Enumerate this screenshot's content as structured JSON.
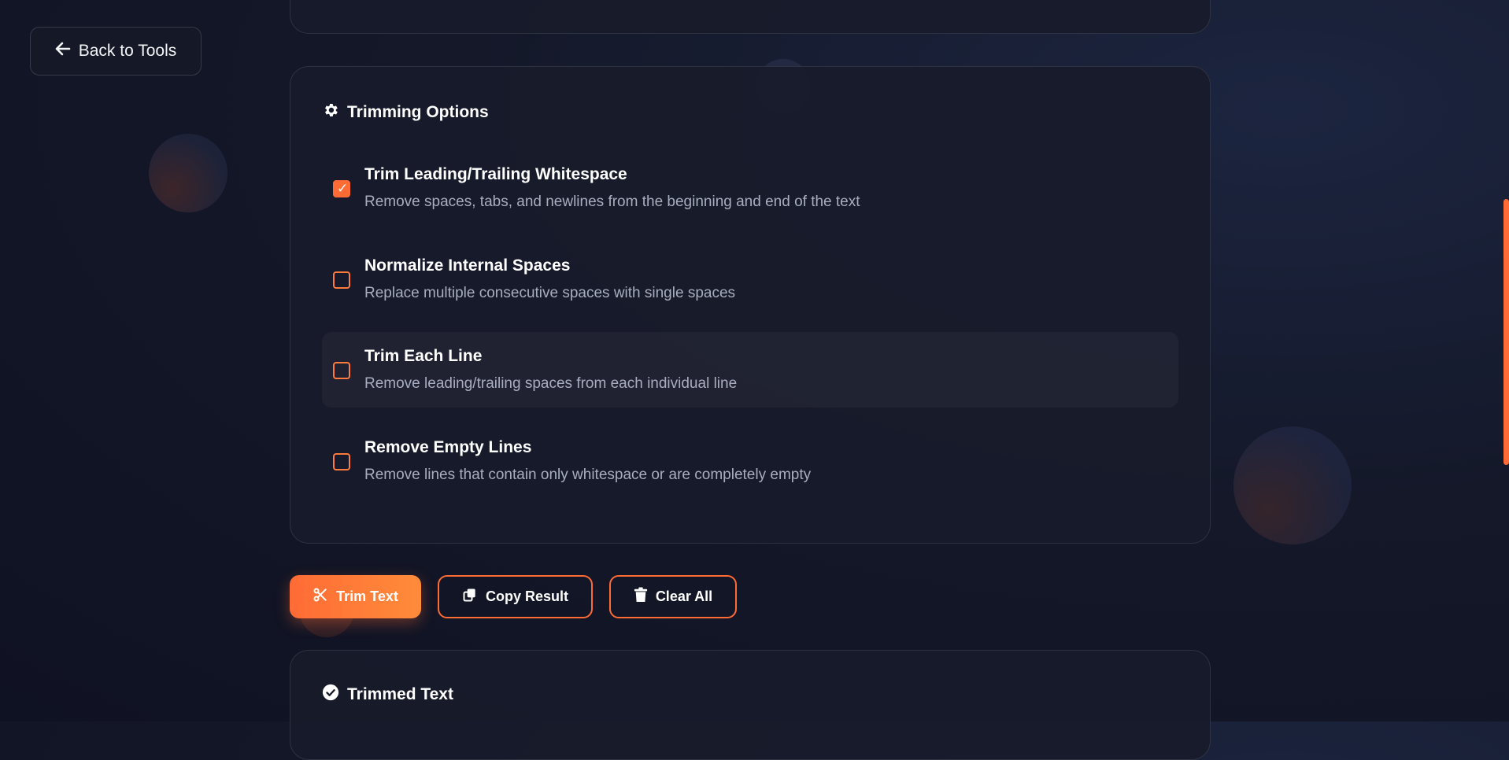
{
  "nav": {
    "back_label": "Back to Tools"
  },
  "options_section": {
    "title": "Trimming Options",
    "items": [
      {
        "label": "Trim Leading/Trailing Whitespace",
        "description": "Remove spaces, tabs, and newlines from the beginning and end of the text",
        "checked": true
      },
      {
        "label": "Normalize Internal Spaces",
        "description": "Replace multiple consecutive spaces with single spaces",
        "checked": false
      },
      {
        "label": "Trim Each Line",
        "description": "Remove leading/trailing spaces from each individual line",
        "checked": false
      },
      {
        "label": "Remove Empty Lines",
        "description": "Remove lines that contain only whitespace or are completely empty",
        "checked": false
      }
    ]
  },
  "actions": {
    "trim_label": "Trim Text",
    "copy_label": "Copy Result",
    "clear_label": "Clear All"
  },
  "result_section": {
    "title": "Trimmed Text"
  },
  "icons": {
    "back": "arrow-left-icon",
    "options": "gear-icon",
    "check": "checkmark-icon",
    "trim": "scissors-icon",
    "copy": "copy-icon",
    "clear": "trash-icon",
    "result": "check-circle-icon"
  },
  "colors": {
    "accent": "#ff6b35",
    "background": "#141829",
    "card": "#181b2a",
    "text_muted": "#a8aec0"
  }
}
